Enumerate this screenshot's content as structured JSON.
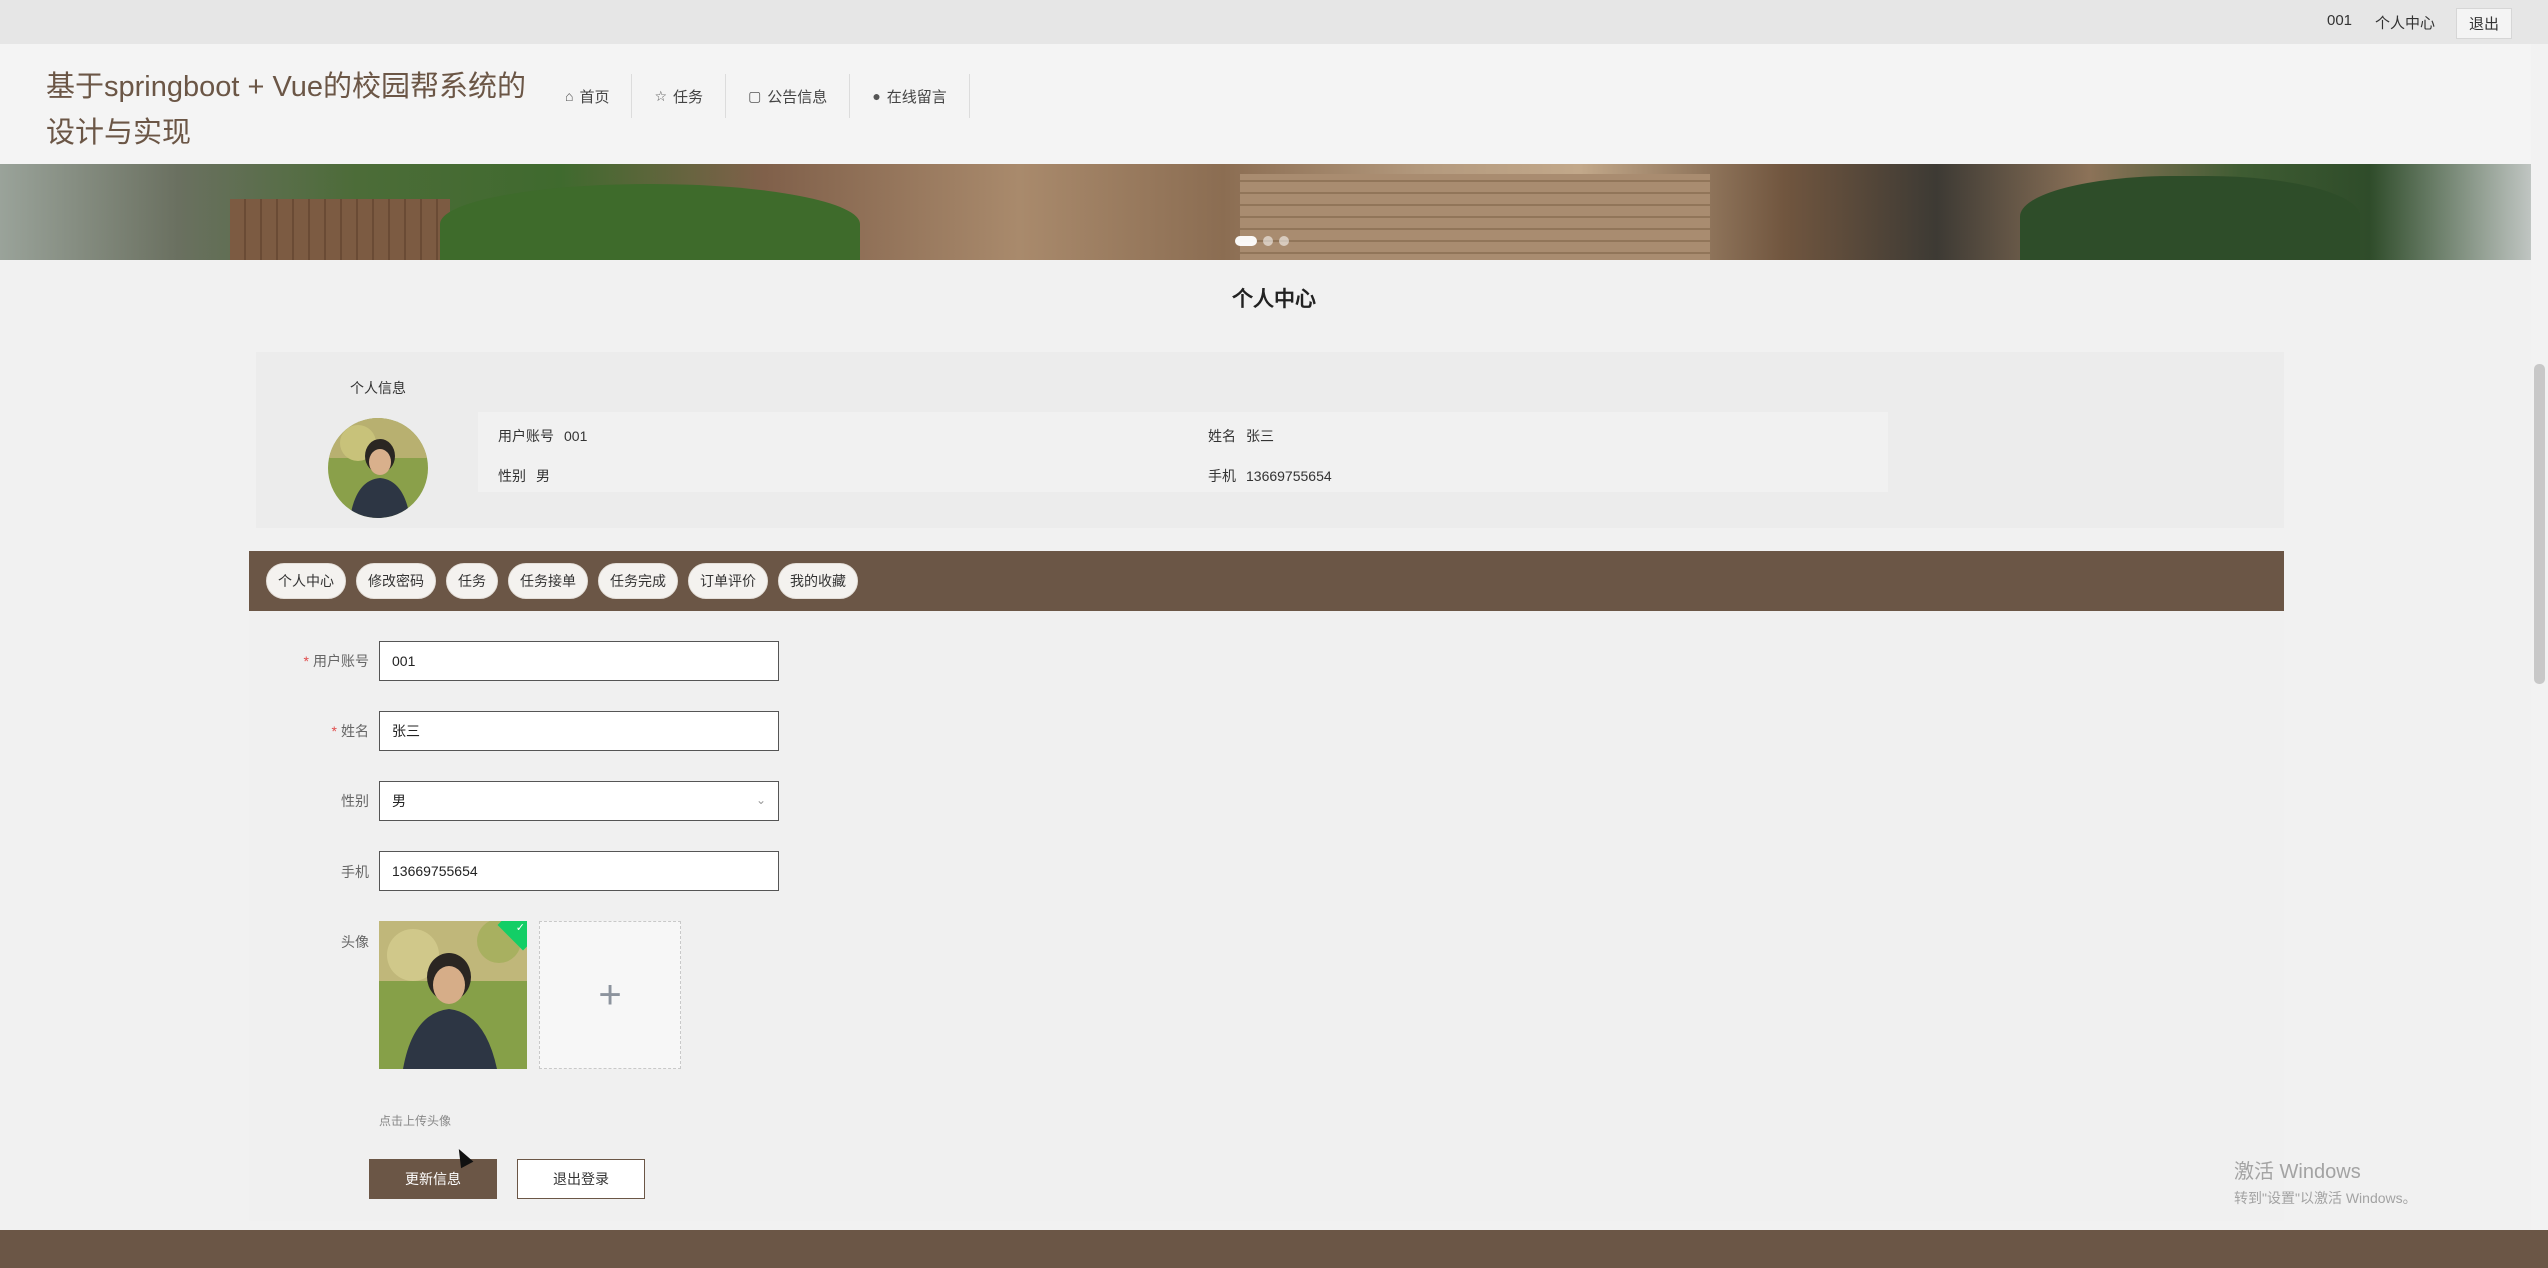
{
  "topbar": {
    "account": "001",
    "center": "个人中心",
    "logout": "退出"
  },
  "header": {
    "title": "基于springboot + Vue的校园帮系统的设计与实现"
  },
  "nav": [
    {
      "icon": "home-icon",
      "glyph": "⌂",
      "label": "首页"
    },
    {
      "icon": "star-icon",
      "glyph": "☆",
      "label": "任务"
    },
    {
      "icon": "bag-icon",
      "glyph": "▢",
      "label": "公告信息"
    },
    {
      "icon": "info-icon",
      "glyph": "●",
      "label": "在线留言"
    }
  ],
  "page": {
    "title": "个人中心"
  },
  "profile": {
    "section_label": "个人信息",
    "account_key": "用户账号",
    "account_val": "001",
    "name_key": "姓名",
    "name_val": "张三",
    "gender_key": "性别",
    "gender_val": "男",
    "phone_key": "手机",
    "phone_val": "13669755654"
  },
  "tabs": [
    "个人中心",
    "修改密码",
    "任务",
    "任务接单",
    "任务完成",
    "订单评价",
    "我的收藏"
  ],
  "form": {
    "account_label": "用户账号",
    "account_value": "001",
    "name_label": "姓名",
    "name_value": "张三",
    "gender_label": "性别",
    "gender_value": "男",
    "phone_label": "手机",
    "phone_value": "13669755654",
    "avatar_label": "头像",
    "upload_tip": "点击上传头像",
    "update_button": "更新信息",
    "logout_button": "退出登录"
  },
  "watermark": {
    "title": "激活 Windows",
    "sub": "转到\"设置\"以激活 Windows。"
  },
  "colors": {
    "brand": "#6b5646",
    "required": "#e04b4b",
    "success": "#13ce66"
  }
}
